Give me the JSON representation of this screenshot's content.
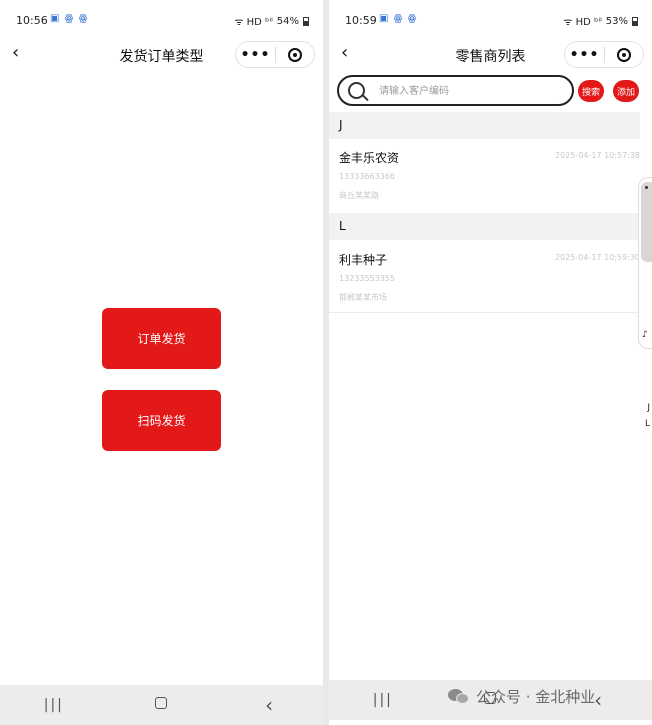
{
  "left_screen": {
    "status": {
      "time": "10:56",
      "notif": "▣ ꙮ ꙮ",
      "signal": "ᯤ HD ᵇⁱˡ",
      "battery": "54%"
    },
    "nav": {
      "back_glyph": "‹",
      "title": "发货订单类型",
      "more_glyph": "•••"
    },
    "buttons": {
      "order_ship": "订单发货",
      "scan_ship": "扫码发货"
    },
    "sysnav": {
      "recents": "|||",
      "back": "‹"
    }
  },
  "right_screen": {
    "status": {
      "time": "10:59",
      "notif": "▣ ꙮ ꙮ",
      "signal": "ᯤ HD ᵇⁱˡ",
      "battery": "53%"
    },
    "nav": {
      "back_glyph": "‹",
      "title": "零售商列表",
      "more_glyph": "•••"
    },
    "search": {
      "placeholder": "请输入客户编码",
      "search_label": "搜索",
      "add_label": "添加"
    },
    "groups": [
      {
        "letter": "J",
        "items": [
          {
            "name": "金丰乐农资",
            "date": "2025-04-17 10:57:38",
            "phone": "13333663366",
            "address": "商丘某某路"
          }
        ]
      },
      {
        "letter": "L",
        "items": [
          {
            "name": "利丰种子",
            "date": "2025-04-17 10:59:30",
            "phone": "13233553355",
            "address": "邯郸某某市场"
          }
        ]
      }
    ],
    "side_index": [
      "J",
      "L"
    ],
    "scroll_tab_mini": "♪",
    "sysnav": {
      "recents": "|||",
      "back": "‹"
    }
  },
  "watermark": {
    "text": "公众号 · 金北种业"
  },
  "colors": {
    "primary_red": "#e31919",
    "section_bg": "#f2f2f2",
    "muted_text": "#c8c8c8"
  }
}
